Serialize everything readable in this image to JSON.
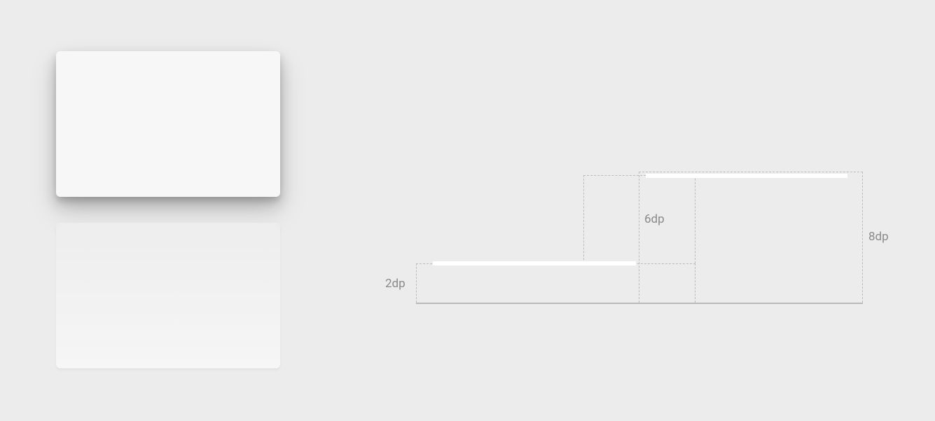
{
  "cards": {
    "top": {
      "elevation_label_ref": "8dp"
    },
    "bottom": {
      "elevation_label_ref": "2dp"
    }
  },
  "diagram": {
    "labels": {
      "dp2": "2dp",
      "dp6": "6dp",
      "dp8": "8dp"
    }
  }
}
